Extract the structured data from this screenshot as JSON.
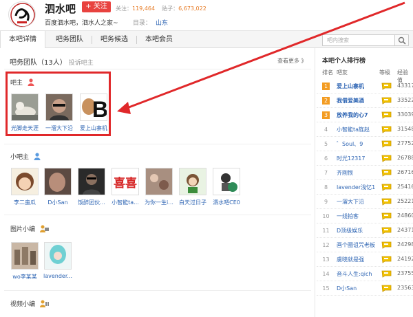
{
  "header": {
    "forum_name": "泗水吧",
    "follow_label": "+ 关注",
    "follow_count_label": "关注：",
    "follow_count": "119,464",
    "post_count_label": "贴子：",
    "post_count": "6,673,022",
    "slogan": "百度泗水吧，泗水人之家~",
    "catalog_label": "目录：",
    "catalog_value": "山东"
  },
  "tabs": [
    "本吧详情",
    "吧务团队",
    "吧务候选",
    "本吧会员"
  ],
  "search": {
    "placeholder": "吧内搜索"
  },
  "team": {
    "title": "吧务团队（13人）",
    "note": "投诉吧主",
    "more": "查看更多 》",
    "roles": {
      "owner": "吧主",
      "sub_owner": "小吧主",
      "picture_editor": "图片小编",
      "video_editor": "视频小编"
    },
    "owners": [
      "光脚走天涯",
      "一溜大下沿",
      "爱上山寨机"
    ],
    "sub_owners": [
      "李二蛮瓜",
      "D小San",
      "饭醉团伙...",
      "小智能ta...",
      "为你一生i...",
      "白天过日子",
      "泗水吧CE0"
    ],
    "picture_editors": [
      "wo李某某",
      "lavender..."
    ]
  },
  "ranking": {
    "title": "本吧个人排行榜",
    "headers": [
      "排名",
      "吧友",
      "等级",
      "经验值"
    ],
    "rows": [
      {
        "rank": "1",
        "name": "爱上山寨机",
        "exp": "43317"
      },
      {
        "rank": "2",
        "name": "我借爱美酒",
        "exp": "33522"
      },
      {
        "rank": "3",
        "name": "放养我的心7",
        "exp": "33039"
      },
      {
        "rank": "4",
        "name": "小智能ta旌赵",
        "exp": "31548"
      },
      {
        "rank": "5",
        "name": "゛Soul、9",
        "exp": "27752"
      },
      {
        "rank": "6",
        "name": "时光12317",
        "exp": "26788"
      },
      {
        "rank": "7",
        "name": "齐刚恨",
        "exp": "26716"
      },
      {
        "rank": "8",
        "name": "lavender浅忆1",
        "exp": "25416"
      },
      {
        "rank": "9",
        "name": "一溜大下沿",
        "exp": "25221"
      },
      {
        "rank": "10",
        "name": "一线拍客",
        "exp": "24860"
      },
      {
        "rank": "11",
        "name": "D顶级娱乐",
        "exp": "24371"
      },
      {
        "rank": "12",
        "name": "画个圈诅咒老板",
        "exp": "24298"
      },
      {
        "rank": "13",
        "name": "虞晓就是强",
        "exp": "24192"
      },
      {
        "rank": "14",
        "name": "音斗人生:qich",
        "exp": "23755"
      },
      {
        "rank": "15",
        "name": "D小San",
        "exp": "23563"
      }
    ]
  },
  "colors": {
    "accent_red": "#e0282a",
    "link_blue": "#2d64b3",
    "follow_red": "#e8423f",
    "rank_orange": "#f39c22"
  }
}
